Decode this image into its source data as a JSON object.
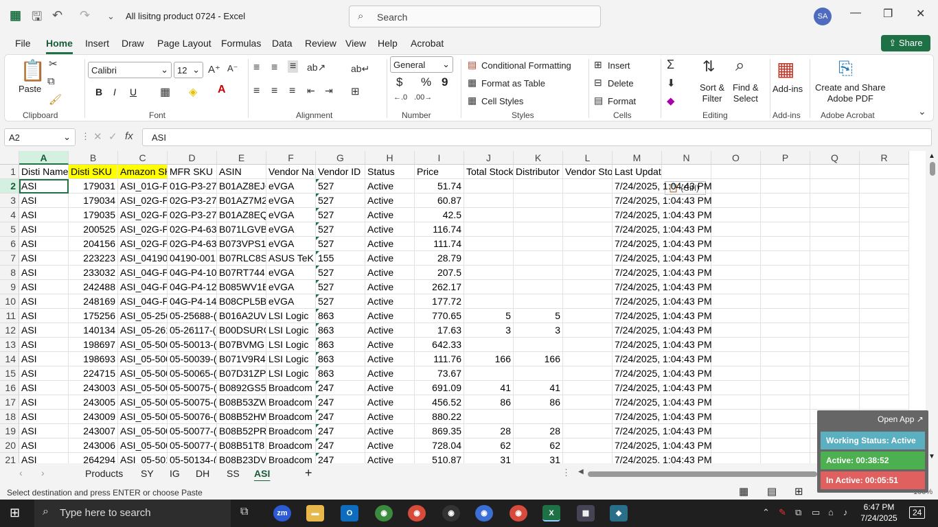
{
  "titlebar": {
    "doc_title": "All lisitng product 0724  -  Excel",
    "search_placeholder": "Search",
    "avatar_initials": "SA"
  },
  "menu": {
    "tabs": [
      "File",
      "Home",
      "Insert",
      "Draw",
      "Page Layout",
      "Formulas",
      "Data",
      "Review",
      "View",
      "Help",
      "Acrobat"
    ],
    "active": "Home",
    "share_label": "Share"
  },
  "ribbon": {
    "clipboard": {
      "paste": "Paste",
      "group": "Clipboard"
    },
    "font": {
      "name": "Calibri",
      "size": "12",
      "group": "Font",
      "bold": "B",
      "italic": "I",
      "underline": "U"
    },
    "alignment": {
      "group": "Alignment"
    },
    "number": {
      "format": "General",
      "group": "Number",
      "currency": "$",
      "percent": "%",
      "comma": "9"
    },
    "styles": {
      "conditional": "Conditional Formatting",
      "table": "Format as Table",
      "cell_styles": "Cell Styles",
      "group": "Styles"
    },
    "cells": {
      "insert": "Insert",
      "delete": "Delete",
      "format": "Format",
      "group": "Cells"
    },
    "editing": {
      "sort": "Sort &\nFilter",
      "find": "Find &\nSelect",
      "group": "Editing"
    },
    "addins": {
      "label": "Add-ins",
      "group": "Add-ins"
    },
    "acrobat": {
      "label": "Create and Share\nAdobe PDF",
      "group": "Adobe Acrobat"
    }
  },
  "formula_bar": {
    "name_box": "A2",
    "fx": "fx",
    "content": "ASI"
  },
  "grid": {
    "columns": [
      "A",
      "B",
      "C",
      "D",
      "E",
      "F",
      "G",
      "H",
      "I",
      "J",
      "K",
      "L",
      "M",
      "N",
      "O",
      "P",
      "Q",
      "R"
    ],
    "selected_column": "A",
    "selected_row": "2",
    "headers": [
      "Disti Name",
      "Disti SKU",
      "Amazon SK",
      "MFR SKU",
      "ASIN",
      "Vendor Na",
      "Vendor ID",
      "Status",
      "Price",
      "Total Stock",
      "Distributor",
      "Vendor Sto",
      "Last Updated"
    ],
    "rows": [
      [
        "2",
        "ASI",
        "179031",
        "ASI_01G-P",
        "01G-P3-27",
        "B01AZ8EJC",
        "eVGA",
        "527",
        "Active",
        "51.74",
        "",
        "",
        "",
        "7/24/2025, 1:04:43 PM"
      ],
      [
        "3",
        "ASI",
        "179034",
        "ASI_02G-P",
        "02G-P3-27",
        "B01AZ7M2",
        "eVGA",
        "527",
        "Active",
        "60.87",
        "",
        "",
        "",
        "7/24/2025, 1:04:43 PM"
      ],
      [
        "4",
        "ASI",
        "179035",
        "ASI_02G-P",
        "02G-P3-27",
        "B01AZ8EQ",
        "eVGA",
        "527",
        "Active",
        "42.5",
        "",
        "",
        "",
        "7/24/2025, 1:04:43 PM"
      ],
      [
        "5",
        "ASI",
        "200525",
        "ASI_02G-P",
        "02G-P4-63",
        "B071LGVB",
        "eVGA",
        "527",
        "Active",
        "116.74",
        "",
        "",
        "",
        "7/24/2025, 1:04:43 PM"
      ],
      [
        "6",
        "ASI",
        "204156",
        "ASI_02G-P",
        "02G-P4-63",
        "B073VPS1",
        "eVGA",
        "527",
        "Active",
        "111.74",
        "",
        "",
        "",
        "7/24/2025, 1:04:43 PM"
      ],
      [
        "7",
        "ASI",
        "223223",
        "ASI_04190",
        "04190-001",
        "B07RLC8S",
        "ASUS TeK",
        "155",
        "Active",
        "28.79",
        "",
        "",
        "",
        "7/24/2025, 1:04:43 PM"
      ],
      [
        "8",
        "ASI",
        "233032",
        "ASI_04G-P",
        "04G-P4-10",
        "B07RT744",
        "eVGA",
        "527",
        "Active",
        "207.5",
        "",
        "",
        "",
        "7/24/2025, 1:04:43 PM"
      ],
      [
        "9",
        "ASI",
        "242488",
        "ASI_04G-P",
        "04G-P4-12",
        "B085WV1E",
        "eVGA",
        "527",
        "Active",
        "262.17",
        "",
        "",
        "",
        "7/24/2025, 1:04:43 PM"
      ],
      [
        "10",
        "ASI",
        "248169",
        "ASI_04G-P",
        "04G-P4-14",
        "B08CPL5B",
        "eVGA",
        "527",
        "Active",
        "177.72",
        "",
        "",
        "",
        "7/24/2025, 1:04:43 PM"
      ],
      [
        "11",
        "ASI",
        "175256",
        "ASI_05-256",
        "05-25688-(",
        "B016A2UV",
        "LSI Logic",
        "863",
        "Active",
        "770.65",
        "5",
        "5",
        "",
        "7/24/2025, 1:04:43 PM"
      ],
      [
        "12",
        "ASI",
        "140134",
        "ASI_05-261",
        "05-26117-(",
        "B00DSURC",
        "LSI Logic",
        "863",
        "Active",
        "17.63",
        "3",
        "3",
        "",
        "7/24/2025, 1:04:43 PM"
      ],
      [
        "13",
        "ASI",
        "198697",
        "ASI_05-500",
        "05-50013-(",
        "B07BVMG",
        "LSI Logic",
        "863",
        "Active",
        "642.33",
        "",
        "",
        "",
        "7/24/2025, 1:04:43 PM"
      ],
      [
        "14",
        "ASI",
        "198693",
        "ASI_05-500",
        "05-50039-(",
        "B071V9R4",
        "LSI Logic",
        "863",
        "Active",
        "111.76",
        "166",
        "166",
        "",
        "7/24/2025, 1:04:43 PM"
      ],
      [
        "15",
        "ASI",
        "224715",
        "ASI_05-500",
        "05-50065-(",
        "B07D31ZP",
        "LSI Logic",
        "863",
        "Active",
        "73.67",
        "",
        "",
        "",
        "7/24/2025, 1:04:43 PM"
      ],
      [
        "16",
        "ASI",
        "243003",
        "ASI_05-500",
        "05-50075-(",
        "B0892GS5",
        "Broadcom",
        "247",
        "Active",
        "691.09",
        "41",
        "41",
        "",
        "7/24/2025, 1:04:43 PM"
      ],
      [
        "17",
        "ASI",
        "243005",
        "ASI_05-500",
        "05-50075-(",
        "B08B53ZW",
        "Broadcom",
        "247",
        "Active",
        "456.52",
        "86",
        "86",
        "",
        "7/24/2025, 1:04:43 PM"
      ],
      [
        "18",
        "ASI",
        "243009",
        "ASI_05-500",
        "05-50076-(",
        "B08B52HW",
        "Broadcom",
        "247",
        "Active",
        "880.22",
        "",
        "",
        "",
        "7/24/2025, 1:04:43 PM"
      ],
      [
        "19",
        "ASI",
        "243007",
        "ASI_05-500",
        "05-50077-(",
        "B08B52PR",
        "Broadcom",
        "247",
        "Active",
        "869.35",
        "28",
        "28",
        "",
        "7/24/2025, 1:04:43 PM"
      ],
      [
        "20",
        "ASI",
        "243006",
        "ASI_05-500",
        "05-50077-(",
        "B08B51T8",
        "Broadcom",
        "247",
        "Active",
        "728.04",
        "62",
        "62",
        "",
        "7/24/2025, 1:04:43 PM"
      ],
      [
        "21",
        "ASI",
        "264294",
        "ASI_05-501",
        "05-50134-(",
        "B08B23DV3",
        "Broadcom",
        "247",
        "Active",
        "510.87",
        "31",
        "31",
        "",
        "7/24/2025, 1:04:43 PM"
      ]
    ],
    "paste_tag": "(Ctrl)"
  },
  "sheet_tabs": {
    "tabs": [
      "Products",
      "SY",
      "IG",
      "DH",
      "SS",
      "ASI"
    ],
    "active": "ASI"
  },
  "status": {
    "message": "Select destination and press ENTER or choose Paste",
    "zoom": "100%"
  },
  "tracker": {
    "open_app": "Open App",
    "working_status": "Working Status: Active",
    "active": "Active: 00:38:52",
    "inactive": "In Active: 00:05:51",
    "colors": {
      "status": "#5ab0c0",
      "active": "#4caf50",
      "inactive": "#e06060"
    }
  },
  "taskbar": {
    "search_placeholder": "Type here to search",
    "time": "6:47 PM",
    "date": "7/24/2025",
    "notifications": "24"
  }
}
